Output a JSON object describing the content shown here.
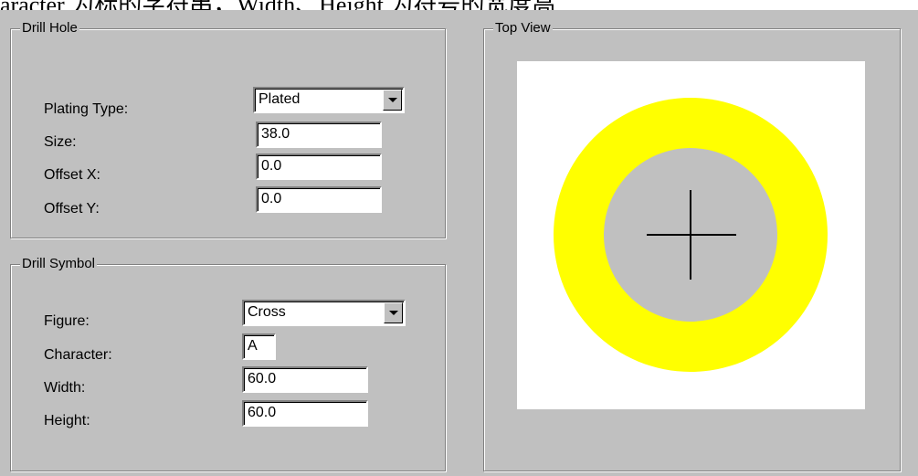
{
  "caption_fragment": "aracter 为标的字符串，Width、Height 为符号的宽度高",
  "drill_hole": {
    "title": "Drill Hole",
    "plating_type_label": "Plating Type:",
    "plating_type_value": "Plated",
    "size_label": "Size:",
    "size_value": "38.0",
    "offset_x_label": "Offset X:",
    "offset_x_value": "0.0",
    "offset_y_label": "Offset Y:",
    "offset_y_value": "0.0"
  },
  "drill_symbol": {
    "title": "Drill Symbol",
    "figure_label": "Figure:",
    "figure_value": "Cross",
    "character_label": "Character:",
    "character_value": "A",
    "width_label": "Width:",
    "width_value": "60.0",
    "height_label": "Height:",
    "height_value": "60.0"
  },
  "top_view": {
    "title": "Top View",
    "pad_color": "#ffff00",
    "hole_color": "#c0c0c0",
    "symbol": "cross"
  },
  "colors": {
    "dialog_bg": "#c0c0c0",
    "field_bg": "#ffffff"
  }
}
